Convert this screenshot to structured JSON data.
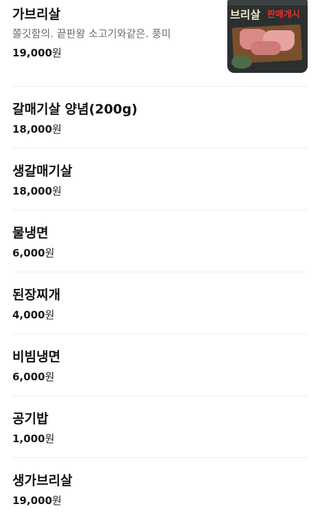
{
  "menu": {
    "items": [
      {
        "name": "가브리살",
        "description": "쫄깃함의. 끝판왕 소고기와같은. 풍미",
        "price_number": "19,000",
        "price_unit": "원",
        "thumbnail": {
          "sign_title": "브리살",
          "sign_red": "판매개시"
        }
      },
      {
        "name": "갈매기살 양념(200g)",
        "price_number": "18,000",
        "price_unit": "원"
      },
      {
        "name": "생갈매기살",
        "price_number": "18,000",
        "price_unit": "원"
      },
      {
        "name": "물냉면",
        "price_number": "6,000",
        "price_unit": "원"
      },
      {
        "name": "된장찌개",
        "price_number": "4,000",
        "price_unit": "원"
      },
      {
        "name": "비빔냉면",
        "price_number": "6,000",
        "price_unit": "원"
      },
      {
        "name": "공기밥",
        "price_number": "1,000",
        "price_unit": "원"
      },
      {
        "name": "생가브리살",
        "price_number": "19,000",
        "price_unit": "원"
      }
    ]
  },
  "colors": {
    "text_primary": "#111111",
    "text_secondary": "#6b6b6b",
    "divider": "#eeeeee",
    "sign_red": "#e0322c"
  }
}
